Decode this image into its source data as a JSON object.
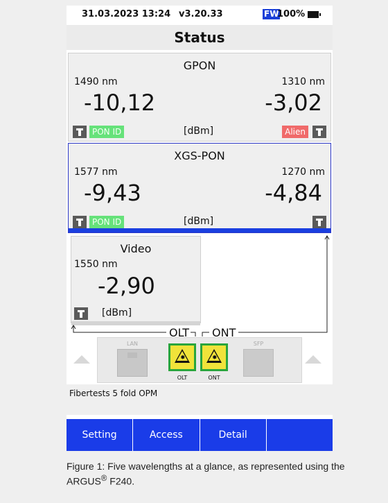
{
  "status_bar": {
    "datetime": "31.03.2023 13:24",
    "version": "v3.20.33",
    "fw_badge": "FW",
    "battery_percent": "100%"
  },
  "title": "Status",
  "gpon": {
    "name": "GPON",
    "left_wavelength": "1490 nm",
    "right_wavelength": "1310 nm",
    "left_value": "-10,12",
    "right_value": "-3,02",
    "unit": "[dBm]",
    "left_tag": "PON ID",
    "right_tag": "Alien"
  },
  "xgs_pon": {
    "name": "XGS-PON",
    "left_wavelength": "1577 nm",
    "right_wavelength": "1270 nm",
    "left_value": "-9,43",
    "right_value": "-4,84",
    "unit": "[dBm]",
    "left_tag": "PON ID"
  },
  "video": {
    "name": "Video",
    "wavelength": "1550 nm",
    "value": "-2,90",
    "unit": "[dBm]"
  },
  "connection_labels": {
    "olt": "OLT",
    "ont": "ONT"
  },
  "device": {
    "lan_label": "LAN",
    "sfp_label": "SFP",
    "olt_port_label": "OLT",
    "ont_port_label": "ONT"
  },
  "test_name": "Fibertests 5 fold OPM",
  "softkeys": [
    "Setting",
    "Access",
    "Detail",
    ""
  ],
  "caption": {
    "text_main": "Figure 1: Five wavelengths at a glance, as represented using the",
    "text_product": "ARGUS",
    "text_reg": "®",
    "text_model": " F240."
  },
  "colors": {
    "softkey_bar": "#1a3ce8",
    "tag_green": "#66e27a",
    "tag_red": "#f06a6a",
    "xgs_active_bar": "#1a3fe0",
    "laser_yellow": "#f1e33a",
    "laser_border": "#2aa53c"
  },
  "icons": {
    "left_arrow": "triangle-up-icon",
    "right_arrow": "triangle-up-icon",
    "laser_warning": "laser-warning-icon",
    "signal": "antenna-icon"
  }
}
